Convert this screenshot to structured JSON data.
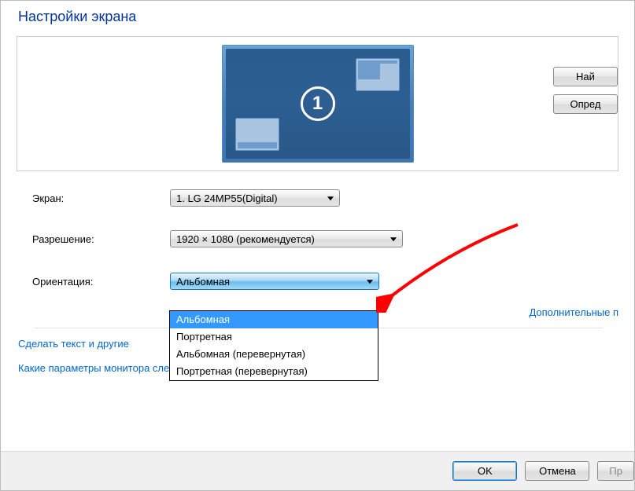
{
  "title": "Настройки экрана",
  "monitor_number": "1",
  "buttons": {
    "find": "Най",
    "detect": "Опред",
    "ok": "OK",
    "cancel": "Отмена",
    "apply": "Пр"
  },
  "labels": {
    "display": "Экран:",
    "resolution": "Разрешение:",
    "orientation": "Ориентация:"
  },
  "values": {
    "display": "1. LG 24MP55(Digital)",
    "resolution": "1920 × 1080 (рекомендуется)",
    "orientation": "Альбомная"
  },
  "orientation_options": [
    "Альбомная",
    "Портретная",
    "Альбомная (перевернутая)",
    "Портретная (перевернутая)"
  ],
  "links": {
    "advanced": "Дополнительные п",
    "resize_text": "Сделать текст и другие",
    "which_settings": "Какие параметры монитора следует выбрать?"
  }
}
